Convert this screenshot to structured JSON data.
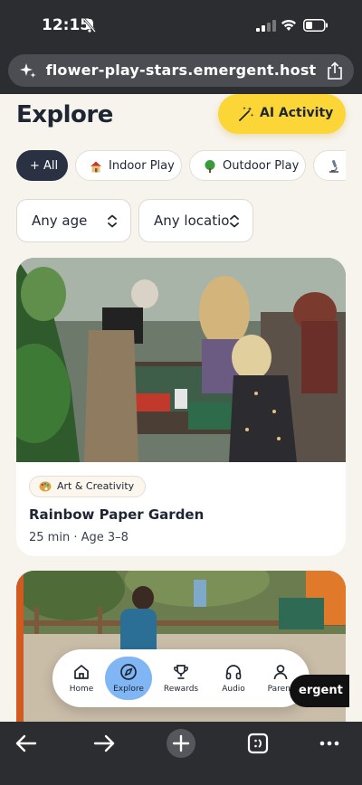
{
  "status_bar": {
    "time": "12:15"
  },
  "browser": {
    "url": "flower-play-stars.emergent.host"
  },
  "header": {
    "title": "Explore",
    "ai_button_label": "AI Activity"
  },
  "filters": {
    "chips": [
      {
        "label": "+ All",
        "active": true
      },
      {
        "label": "Indoor Play",
        "icon": "house-icon"
      },
      {
        "label": "Outdoor Play",
        "icon": "tree-icon"
      },
      {
        "label": "",
        "icon": "microscope-icon"
      }
    ],
    "age_select": "Any age",
    "location_select": "Any location"
  },
  "cards": [
    {
      "tag": "Art & Creativity",
      "tag_icon": "palette-icon",
      "title": "Rainbow Paper Garden",
      "meta": "25 min · Age 3–8"
    }
  ],
  "nav": {
    "items": [
      {
        "label": "Home",
        "icon": "home-icon"
      },
      {
        "label": "Explore",
        "icon": "compass-icon",
        "active": true
      },
      {
        "label": "Rewards",
        "icon": "trophy-icon"
      },
      {
        "label": "Audio",
        "icon": "headphones-icon"
      },
      {
        "label": "Parent",
        "icon": "person-icon"
      }
    ]
  },
  "badge": {
    "text": "ergent"
  },
  "colors": {
    "accent_yellow": "#fbd636",
    "nav_active": "#7fb6f3",
    "chip_active": "#2a3142",
    "page_bg": "#f7f4ee"
  }
}
